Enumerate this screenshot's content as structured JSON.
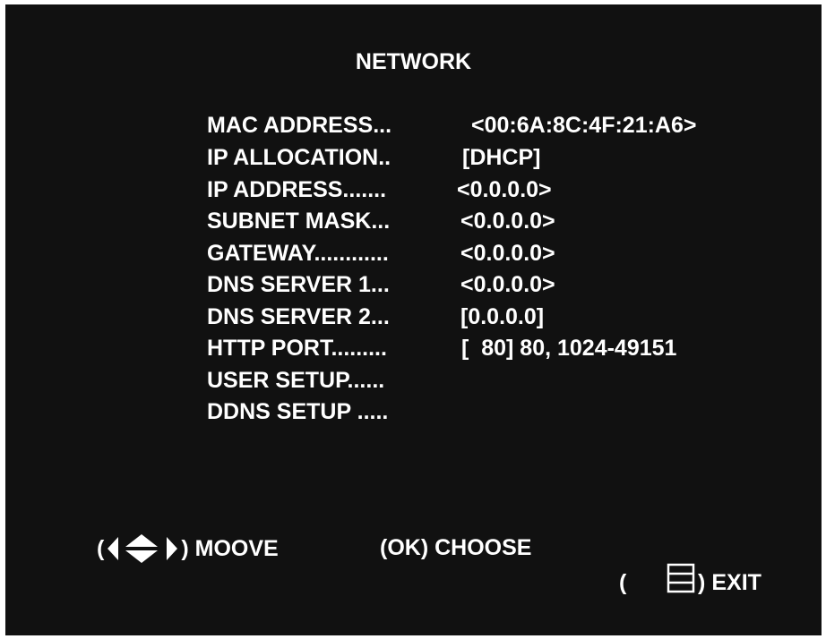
{
  "title": "NETWORK",
  "rows": [
    {
      "label": "MAC ADDRESS...",
      "value": "<00:6A:8C:4F:21:A6>"
    },
    {
      "label": "IP ALLOCATION..",
      "value": "[DHCP]"
    },
    {
      "label": "IP ADDRESS.......",
      "value": "<0.0.0.0>"
    },
    {
      "label": "SUBNET MASK...",
      "value": "<0.0.0.0>"
    },
    {
      "label": "GATEWAY............",
      "value": "<0.0.0.0>"
    },
    {
      "label": "DNS SERVER 1...",
      "value": "<0.0.0.0>"
    },
    {
      "label": "DNS SERVER 2...",
      "value": "[0.0.0.0]"
    },
    {
      "label": "HTTP PORT.........",
      "value": "[  80] 80, 1024-49151"
    },
    {
      "label": "USER SETUP......",
      "value": ""
    },
    {
      "label": "DDNS SETUP .....",
      "value": ""
    }
  ],
  "footer": {
    "move": {
      "open": "(",
      "close": ")",
      "label": "MOOVE",
      "icon": "arrow-keys-icon"
    },
    "choose": {
      "label": "(OK) CHOOSE"
    },
    "exit": {
      "open": "(",
      "close": ")",
      "label": "EXIT",
      "icon": "menu-icon"
    }
  },
  "colors": {
    "background": "#111111",
    "text": "#ffffff",
    "frame": "#ffffff"
  }
}
